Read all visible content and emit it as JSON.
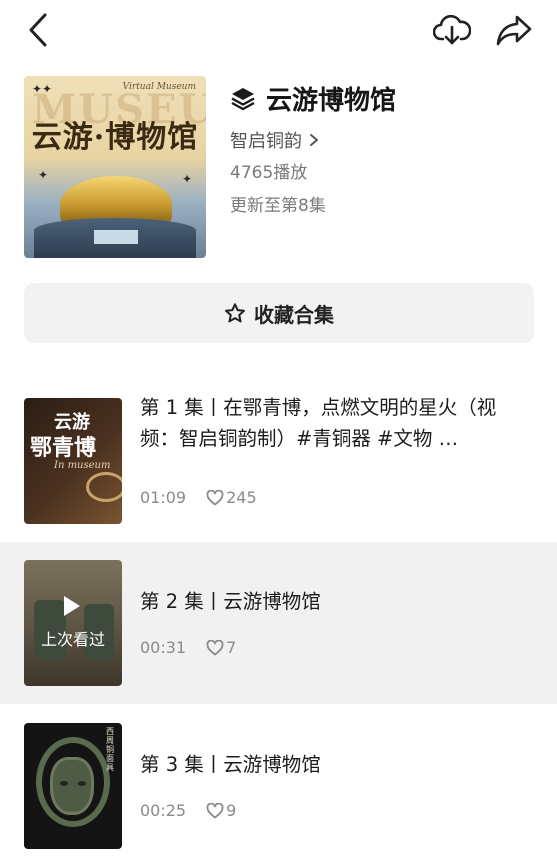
{
  "topbar": {
    "back_icon": "chevron-left-icon",
    "download_icon": "cloud-download-icon",
    "share_icon": "share-arrow-icon"
  },
  "collection": {
    "title": "云游博物馆",
    "title_icon": "layers-icon",
    "author": "智启铜韵",
    "plays": "4765播放",
    "update_status": "更新至第8集",
    "cover": {
      "overlay_word": "MUSEUM",
      "subtitle": "Virtual Museum",
      "title": "云游·博物馆"
    }
  },
  "collect_button": {
    "label": "收藏合集",
    "icon": "star-outline-icon"
  },
  "episodes": [
    {
      "title": "第 1 集丨在鄂青博，点燃文明的星火（视频：智启铜韵制）#青铜器 #文物 …",
      "duration": "01:09",
      "likes": "245",
      "thumb": {
        "line1": "云游",
        "line2": "鄂青博",
        "line3": "In museum"
      }
    },
    {
      "title": "第 2 集丨云游博物馆",
      "duration": "00:31",
      "likes": "7",
      "thumb": {
        "overlay": "上次看过"
      },
      "active": true
    },
    {
      "title": "第 3 集丨云游博物馆",
      "duration": "00:25",
      "likes": "9",
      "thumb": {
        "seal_text": "西周铜面具"
      }
    }
  ],
  "colors": {
    "active_row": "#f1f1f1",
    "button_bg": "#f2f2f2",
    "text_primary": "#1c1c1c",
    "text_secondary": "#8a8a8a"
  }
}
